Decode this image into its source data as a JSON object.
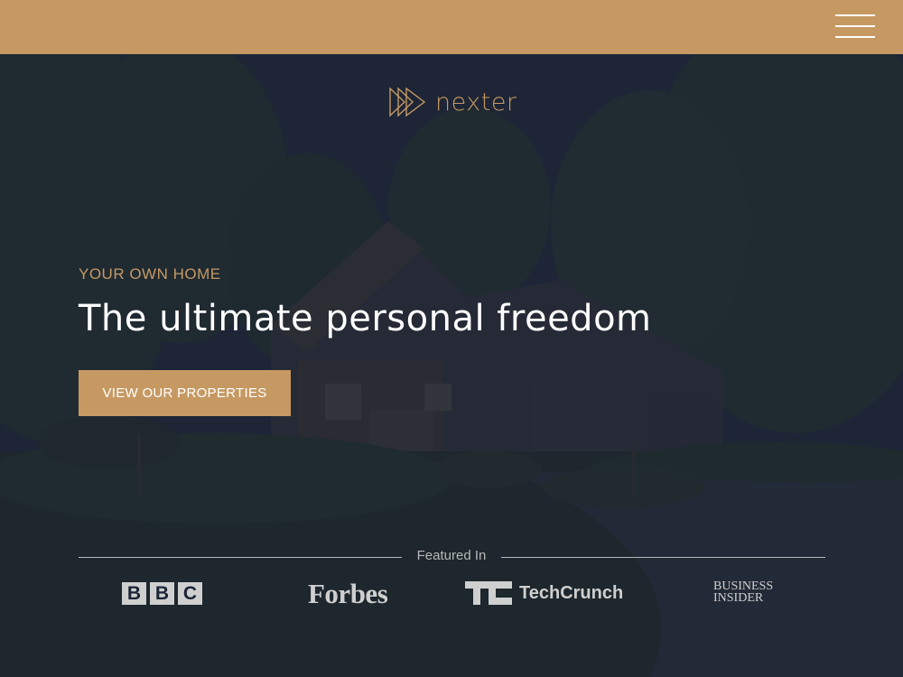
{
  "header": {
    "menu_icon": "hamburger-icon",
    "background": "#c69963"
  },
  "brand": {
    "name": "nexter",
    "logo_icon": "triple-play-logo-icon",
    "color": "#c69963"
  },
  "hero": {
    "subtitle": "YOUR OWN HOME",
    "title": "The ultimate personal freedom",
    "cta_label": "VIEW OUR PROPERTIES",
    "background_image": "house-at-dusk"
  },
  "featured": {
    "label": "Featured In",
    "logos": [
      {
        "name": "BBC",
        "letters": [
          "B",
          "B",
          "C"
        ]
      },
      {
        "name": "Forbes"
      },
      {
        "name": "TechCrunch",
        "mark": "TC"
      },
      {
        "name": "Business Insider",
        "line1": "BUSINESS",
        "line2": "INSIDER"
      }
    ]
  },
  "colors": {
    "accent": "#c69963",
    "overlay": "#161d30",
    "text": "#ffffff",
    "muted": "#b8b8b8"
  }
}
